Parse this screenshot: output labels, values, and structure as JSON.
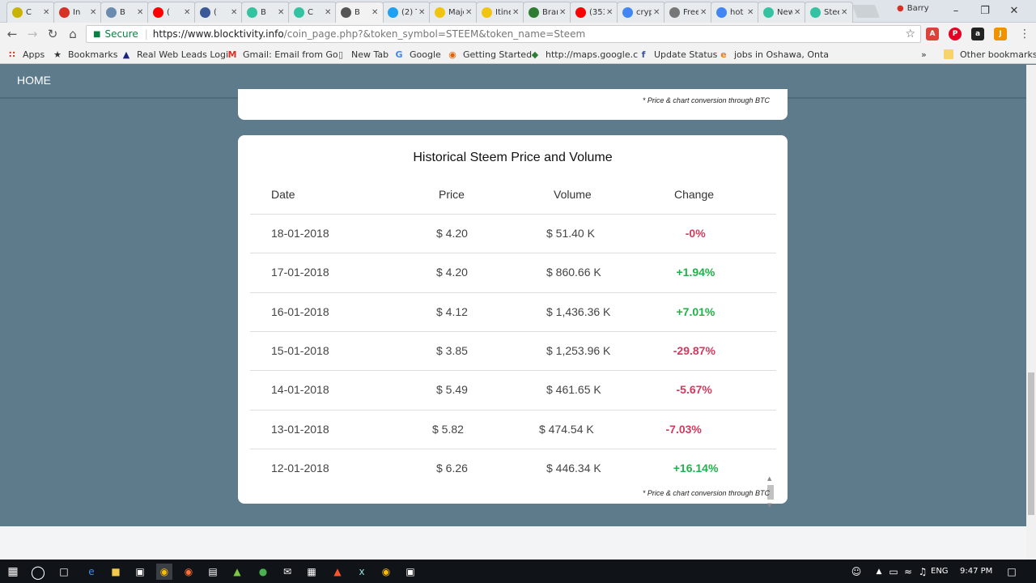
{
  "browser": {
    "tabs": [
      {
        "label": "C",
        "icon": "coin-icon",
        "color": "#c8b400"
      },
      {
        "label": "In",
        "icon": "gmail-icon",
        "color": "#d93025"
      },
      {
        "label": "B",
        "icon": "bitcoin-icon",
        "color": "#6b8cae"
      },
      {
        "label": "(",
        "icon": "youtube-icon",
        "color": "#ff0000"
      },
      {
        "label": "(",
        "icon": "facebook-icon",
        "color": "#3b5998"
      },
      {
        "label": "B",
        "icon": "blocktivity-icon",
        "color": "#33c3a0"
      },
      {
        "label": "C",
        "icon": "blocktivity-icon",
        "color": "#33c3a0"
      },
      {
        "label": "B",
        "icon": "loading-icon",
        "color": "#555555"
      },
      {
        "label": "(2) T",
        "icon": "twitter-icon",
        "color": "#1da1f2"
      },
      {
        "label": "Majo",
        "icon": "doc-icon",
        "color": "#f1c40f"
      },
      {
        "label": "Itine",
        "icon": "doc-icon",
        "color": "#f1c40f"
      },
      {
        "label": "Bran",
        "icon": "maps-icon",
        "color": "#2e7d32"
      },
      {
        "label": "(353",
        "icon": "youtube-icon",
        "color": "#ff0000"
      },
      {
        "label": "crypt",
        "icon": "google-icon",
        "color": "#4285f4"
      },
      {
        "label": "Free",
        "icon": "images-icon",
        "color": "#777777"
      },
      {
        "label": "hot p",
        "icon": "google-icon",
        "color": "#4285f4"
      },
      {
        "label": "New",
        "icon": "blocktivity-icon",
        "color": "#33c3a0"
      },
      {
        "label": "Steer",
        "icon": "blocktivity-icon",
        "color": "#33c3a0"
      }
    ],
    "profile_name": "Barry",
    "secure_label": "Secure",
    "url_host": "https://www.blocktivity.info",
    "url_path": "/coin_page.php?&token_symbol=STEEM&token_name=Steem",
    "bookmarks": [
      {
        "label": "Apps",
        "icon": "apps-icon"
      },
      {
        "label": "Bookmarks",
        "icon": "star-icon"
      },
      {
        "label": "Real Web Leads Logi",
        "icon": "leads-icon"
      },
      {
        "label": "Gmail: Email from Go",
        "icon": "gmail-icon"
      },
      {
        "label": "New Tab",
        "icon": "page-icon"
      },
      {
        "label": "Google",
        "icon": "google-icon"
      },
      {
        "label": "Getting Started",
        "icon": "firefox-icon"
      },
      {
        "label": "http://maps.google.c",
        "icon": "maps-icon"
      },
      {
        "label": "Update Status",
        "icon": "facebook-icon"
      },
      {
        "label": "jobs in Oshawa, Onta",
        "icon": "search-icon"
      }
    ],
    "other_bookmarks": "Other bookmarks"
  },
  "page": {
    "nav_home": "HOME",
    "note_top": "* Price & chart conversion through BTC",
    "table_title": "Historical Steem Price and Volume",
    "headers": {
      "date": "Date",
      "price": "Price",
      "volume": "Volume",
      "change": "Change"
    },
    "rows": [
      {
        "date": "18-01-2018",
        "price": "$ 4.20",
        "volume": "$ 51.40 K",
        "change": "-0%",
        "positive": false
      },
      {
        "date": "17-01-2018",
        "price": "$ 4.20",
        "volume": "$ 860.66 K",
        "change": "+1.94%",
        "positive": true
      },
      {
        "date": "16-01-2018",
        "price": "$ 4.12",
        "volume": "$ 1,436.36 K",
        "change": "+7.01%",
        "positive": true
      },
      {
        "date": "15-01-2018",
        "price": "$ 3.85",
        "volume": "$ 1,253.96 K",
        "change": "-29.87%",
        "positive": false
      },
      {
        "date": "14-01-2018",
        "price": "$ 5.49",
        "volume": "$ 461.65 K",
        "change": "-5.67%",
        "positive": false
      },
      {
        "date": "13-01-2018",
        "price": "$ 5.82",
        "volume": "$ 474.54 K",
        "change": "-7.03%",
        "positive": false
      },
      {
        "date": "12-01-2018",
        "price": "$ 6.26",
        "volume": "$ 446.34 K",
        "change": "+16.14%",
        "positive": true
      }
    ],
    "note_bottom": "* Price & chart conversion through BTC"
  },
  "colors": {
    "positive": "#21b14a",
    "negative": "#d23a5e",
    "page_bg": "#5e7b8c"
  },
  "taskbar": {
    "language": "ENG",
    "time": "9:47 PM"
  }
}
